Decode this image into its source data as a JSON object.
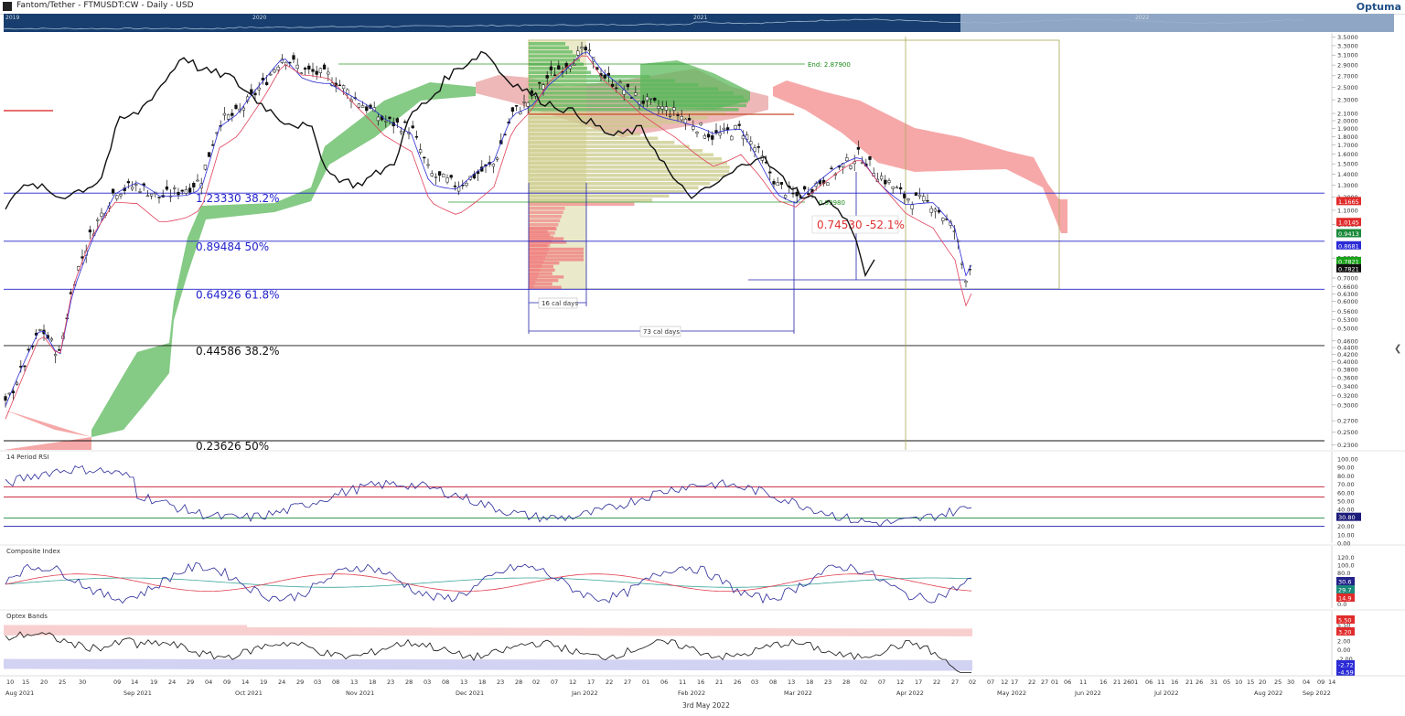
{
  "header": {
    "title": "Fantom/Tether - FTMUSDT:CW - Daily - USD",
    "brand": "Optuma",
    "navigator_years": [
      "2019",
      "2020",
      "2021",
      "2022"
    ]
  },
  "chart_data": [
    {
      "type": "line",
      "title": "",
      "series": [],
      "y_scale": "log",
      "y_ticks": [
        "3.5000",
        "3.3000",
        "3.1000",
        "2.9000",
        "2.7000",
        "2.5000",
        "2.3000",
        "2.1000",
        "2.0000",
        "1.9000",
        "1.8000",
        "1.7000",
        "1.6000",
        "1.5000",
        "1.4000",
        "1.3000",
        "1.2000",
        "1.1000",
        "1.0000",
        "0.8000",
        "0.7000",
        "0.6600",
        "0.6300",
        "0.6000",
        "0.5600",
        "0.5300",
        "0.5000",
        "0.4600",
        "0.4400",
        "0.4200",
        "0.4000",
        "0.3800",
        "0.3600",
        "0.3400",
        "0.3200",
        "0.3000",
        "0.2700",
        "0.2500",
        "0.2300"
      ],
      "y_values": [
        3.5,
        3.3,
        3.1,
        2.9,
        2.7,
        2.5,
        2.3,
        2.1,
        2.0,
        1.9,
        1.8,
        1.7,
        1.6,
        1.5,
        1.4,
        1.3,
        1.2,
        1.1,
        1.0,
        0.8,
        0.7,
        0.66,
        0.63,
        0.6,
        0.56,
        0.53,
        0.5,
        0.46,
        0.44,
        0.42,
        0.4,
        0.38,
        0.36,
        0.34,
        0.32,
        0.3,
        0.27,
        0.25,
        0.23
      ],
      "price_badges": [
        {
          "text": "1.1665",
          "value": 1.1665,
          "color": "#e02b2b"
        },
        {
          "text": "1.0145",
          "value": 1.0145,
          "color": "#e02b2b"
        },
        {
          "text": "0.9413",
          "value": 0.9413,
          "color": "#1a8a3a"
        },
        {
          "text": "0.8681",
          "value": 0.8681,
          "color": "#2b2bd6"
        },
        {
          "text": "0.7821",
          "value": 0.7821,
          "color": "#1aa31a"
        },
        {
          "text": "0.7821",
          "value": 0.7821,
          "color": "#111111"
        }
      ],
      "fib_levels": [
        {
          "price": "1.23330",
          "pct": "38.2%",
          "value": 1.2333,
          "color": "#2222cc"
        },
        {
          "price": "0.89484",
          "pct": "50%",
          "value": 0.89484,
          "color": "#2222cc"
        },
        {
          "price": "0.64926",
          "pct": "61.8%",
          "value": 0.64926,
          "color": "#2222cc"
        },
        {
          "price": "0.44586",
          "pct": "38.2%",
          "value": 0.44586,
          "color": "#111111"
        },
        {
          "price": "0.23626",
          "pct": "50%",
          "value": 0.23626,
          "color": "#111111"
        }
      ],
      "annotations": {
        "end_label": "End: 2.87900",
        "change_label": "0.74530  -52.1%",
        "span_short": "16 cal days",
        "span_long": "73 cal days",
        "poc_label": "0.99980"
      }
    },
    {
      "type": "line",
      "title": "14 Period RSI",
      "series": [],
      "y_ticks": [
        "100.00",
        "90.00",
        "80.00",
        "70.00",
        "60.00",
        "50.00",
        "40.00",
        "30.00",
        "20.00",
        "10.00",
        "0.00"
      ],
      "y_values": [
        100,
        90,
        80,
        70,
        60,
        50,
        40,
        30,
        20,
        10,
        0
      ],
      "last_value": "30.80",
      "ylim": [
        0,
        100
      ]
    },
    {
      "type": "line",
      "title": "Composite Index",
      "series": [],
      "y_ticks": [
        "120.0",
        "100.0",
        "80.0",
        "40.0",
        "0.0"
      ],
      "y_values": [
        120,
        100,
        80,
        40,
        0
      ],
      "ylim": [
        -10,
        130
      ],
      "badges": [
        {
          "text": "30.6",
          "value": 30.6,
          "color": "#22228a"
        },
        {
          "text": "29.7",
          "value": 29.7,
          "color": "#1a8a7a"
        },
        {
          "text": "14.9",
          "value": 14.9,
          "color": "#e02b2b"
        }
      ]
    },
    {
      "type": "line",
      "title": "Optex Bands",
      "series": [],
      "y_ticks": [
        "5.50",
        "2.00",
        "0.00",
        "-2.00"
      ],
      "y_values": [
        5.5,
        2.0,
        0.0,
        -2.0
      ],
      "ylim": [
        -5.5,
        7
      ],
      "badges": [
        {
          "text": "5.50",
          "value": 5.5,
          "color": "#e02b2b"
        },
        {
          "text": "3.20",
          "value": 3.2,
          "color": "#e02b2b"
        },
        {
          "text": "-2.72",
          "value": -2.72,
          "color": "#2b2bd6"
        },
        {
          "text": "-4.59",
          "value": -4.59,
          "color": "#2b2bd6"
        }
      ]
    }
  ],
  "x_axis": {
    "days": [
      "10",
      "15",
      "20",
      "25",
      "30",
      "09",
      "14",
      "19",
      "24",
      "29",
      "04",
      "09",
      "14",
      "19",
      "24",
      "29",
      "03",
      "08",
      "13",
      "18",
      "23",
      "28",
      "03",
      "08",
      "13",
      "18",
      "23",
      "28",
      "02",
      "07",
      "12",
      "17",
      "22",
      "27",
      "01",
      "06",
      "11",
      "16",
      "21",
      "26",
      "03",
      "08",
      "13",
      "18",
      "23",
      "28",
      "02",
      "07",
      "12",
      "17",
      "22",
      "27",
      "02",
      "07",
      "12",
      "17",
      "22",
      "27",
      "01",
      "06",
      "11",
      "16",
      "21",
      "26",
      "01",
      "06",
      "11",
      "16",
      "21",
      "26",
      "31",
      "05",
      "10",
      "15",
      "20",
      "25",
      "30",
      "04",
      "09",
      "14"
    ],
    "months": [
      "Aug 2021",
      "Sep 2021",
      "Oct 2021",
      "Nov 2021",
      "Dec 2021",
      "Jan 2022",
      "Feb 2022",
      "Mar 2022",
      "Apr 2022",
      "May 2022",
      "Jun 2022",
      "Jul 2022",
      "Aug 2022",
      "Sep 2022"
    ],
    "date_label": "3rd May 2022"
  }
}
